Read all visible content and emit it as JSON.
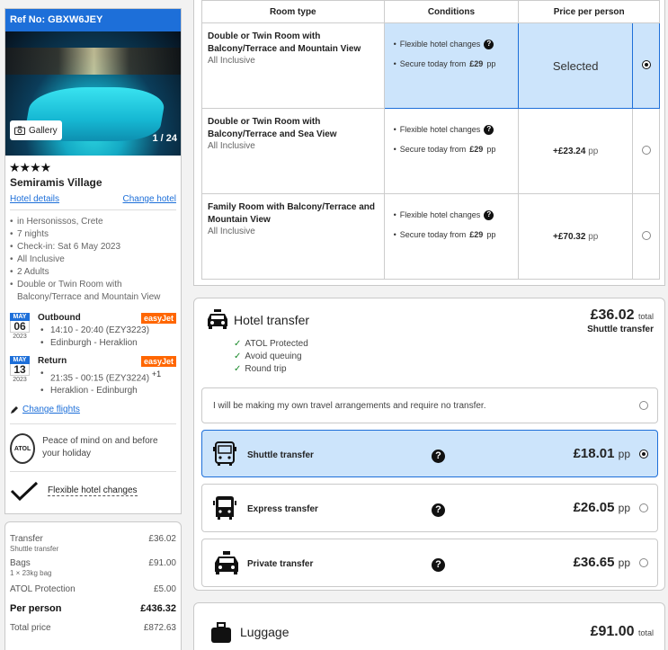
{
  "sidebar": {
    "ref": "Ref No: GBXW6JEY",
    "gallery_label": "Gallery",
    "photo_count": "1 / 24",
    "stars": "★★★★",
    "hotel_name": "Semiramis Village",
    "hotel_details": "Hotel details",
    "change_hotel": "Change hotel",
    "info": [
      "in Hersonissos, Crete",
      "7 nights",
      "Check-in: Sat 6 May 2023",
      "All Inclusive",
      "2 Adults",
      "Double or Twin Room with Balcony/Terrace and Mountain View"
    ],
    "outbound": {
      "mon": "MAY",
      "day": "06",
      "yr": "2023",
      "title": "Outbound",
      "airline": "easyJet",
      "time": "14:10 - 20:40 (EZY3223)",
      "route": "Edinburgh - Heraklion"
    },
    "return": {
      "mon": "MAY",
      "day": "13",
      "yr": "2023",
      "title": "Return",
      "airline": "easyJet",
      "time": "21:35 - 00:15 (EZY3224)",
      "plus": "+1",
      "route": "Heraklion - Edinburgh"
    },
    "change_flights": "Change flights",
    "atol_text": "ATOL",
    "peace": "Peace of mind on and before your holiday",
    "flex": "Flexible hotel changes"
  },
  "summary": {
    "transfer_label": "Transfer",
    "transfer_sub": "Shuttle transfer",
    "transfer_val": "£36.02",
    "bags_label": "Bags",
    "bags_sub": "1 × 23kg bag",
    "bags_val": "£91.00",
    "atol_label": "ATOL Protection",
    "atol_val": "£5.00",
    "pp_label": "Per person",
    "pp_val": "£436.32",
    "total_label": "Total price",
    "total_val": "£872.63"
  },
  "rooms": {
    "headers": [
      "Room type",
      "Conditions",
      "Price per person"
    ],
    "cond1": "Flexible hotel changes",
    "cond2_prefix": "Secure today from ",
    "cond2_amt": "£29",
    "cond2_suffix": " pp",
    "pp": "pp",
    "items": [
      {
        "name": "Double or Twin Room with Balcony/Terrace and Mountain View",
        "board": "All Inclusive",
        "price": "Selected"
      },
      {
        "name": "Double or Twin Room with Balcony/Terrace and Sea View",
        "board": "All Inclusive",
        "price": "+£23.24"
      },
      {
        "name": "Family Room with Balcony/Terrace and Mountain View",
        "board": "All Inclusive",
        "price": "+£70.32"
      }
    ]
  },
  "transfer": {
    "title": "Hotel transfer",
    "total": "£36.02",
    "total_lbl": "total",
    "selected_name": "Shuttle transfer",
    "checks": [
      "ATOL Protected",
      "Avoid queuing",
      "Round trip"
    ],
    "none_label": "I will be making my own travel arrangements and require no transfer.",
    "options": [
      {
        "name": "Shuttle transfer",
        "price": "£18.01"
      },
      {
        "name": "Express transfer",
        "price": "£26.05"
      },
      {
        "name": "Private transfer",
        "price": "£36.65"
      }
    ],
    "pp": "pp"
  },
  "luggage": {
    "title": "Luggage",
    "total": "£91.00",
    "total_lbl": "total"
  }
}
